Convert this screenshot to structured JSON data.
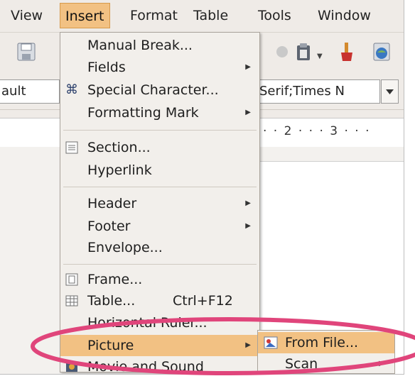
{
  "menubar": {
    "items": [
      {
        "label": "View",
        "accel": "V"
      },
      {
        "label": "Insert",
        "accel": "I"
      },
      {
        "label": "Format",
        "accel": "o"
      },
      {
        "label": "Table",
        "accel": "a"
      },
      {
        "label": "Tools",
        "accel": "T"
      },
      {
        "label": "Window",
        "accel": "W"
      }
    ]
  },
  "toolbar": {
    "style_value": "ault",
    "font_value": "Serif;Times N",
    "ruler_text": "· · 2 · · · 3 · · ·"
  },
  "insert_menu": {
    "items": [
      {
        "label": "Manual Break...",
        "submenu": false
      },
      {
        "label": "Fields",
        "submenu": true
      },
      {
        "label": "Special Character...",
        "submenu": false,
        "icon": "special-character-icon"
      },
      {
        "label": "Formatting Mark",
        "submenu": true
      },
      {
        "label": "Section...",
        "submenu": false,
        "icon": "section-icon"
      },
      {
        "label": "Hyperlink",
        "submenu": false
      },
      {
        "label": "Header",
        "submenu": true
      },
      {
        "label": "Footer",
        "submenu": true
      },
      {
        "label": "Envelope...",
        "submenu": false
      },
      {
        "label": "Frame...",
        "submenu": false,
        "icon": "frame-icon"
      },
      {
        "label": "Table...",
        "shortcut": "Ctrl+F12",
        "submenu": false,
        "icon": "table-icon"
      },
      {
        "label": "Horizontal Ruler...",
        "submenu": false
      },
      {
        "label": "Picture",
        "submenu": true,
        "highlighted": true
      },
      {
        "label": "Movie and Sound",
        "submenu": false,
        "icon": "movie-icon"
      }
    ]
  },
  "picture_submenu": {
    "items": [
      {
        "label": "From File...",
        "highlighted": true,
        "icon": "image-file-icon"
      },
      {
        "label": "Scan",
        "submenu": true
      }
    ]
  },
  "colors": {
    "menu_highlight": "#f2c183",
    "annotation_ellipse": "#e0457b"
  }
}
